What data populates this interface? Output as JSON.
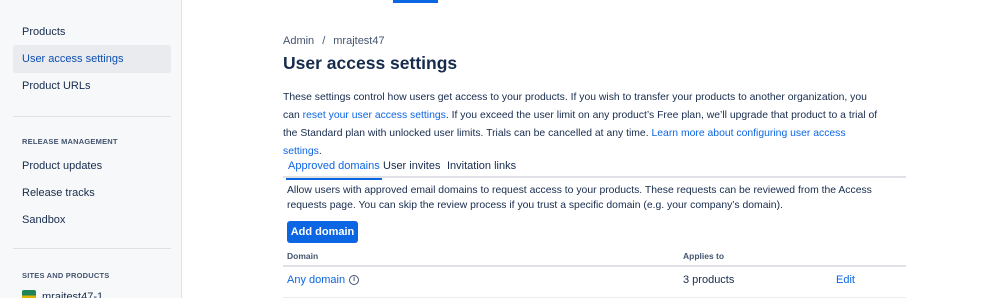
{
  "sidebar": {
    "items_top": [
      {
        "label": "Products"
      },
      {
        "label": "User access settings",
        "active": true
      },
      {
        "label": "Product URLs"
      }
    ],
    "release_heading": "RELEASE MANAGEMENT",
    "release_items": [
      {
        "label": "Product updates"
      },
      {
        "label": "Release tracks"
      },
      {
        "label": "Sandbox"
      }
    ],
    "sites_heading": "SITES AND PRODUCTS",
    "site": {
      "label": "mrajtest47-1",
      "icon": "site-icon"
    }
  },
  "breadcrumb": {
    "items": [
      "Admin",
      "mrajtest47"
    ],
    "separator": "/"
  },
  "page_title": "User access settings",
  "intro": {
    "part1": "These settings control how users get access to your products. If you wish to transfer your products to another organization, you can ",
    "link1": "reset your user access settings",
    "part2": ". If you exceed the user limit on any product’s Free plan, we’ll upgrade that product to a trial of the Standard plan with unlocked user limits. Trials can be cancelled at any time. ",
    "link2": "Learn more about configuring user access settings",
    "part3": "."
  },
  "tabs": [
    {
      "label": "Approved domains",
      "active": true
    },
    {
      "label": "User invites"
    },
    {
      "label": "Invitation links"
    }
  ],
  "tab_description": "Allow users with approved email domains to request access to your products. These requests can be reviewed from the Access requests page. You can skip the review process if you trust a specific domain (e.g. your company’s domain).",
  "add_button": "Add domain",
  "table": {
    "headers": [
      "Domain",
      "Applies to"
    ],
    "rows": [
      {
        "domain": "Any domain",
        "applies_to": "3 products",
        "action": "Edit"
      }
    ]
  },
  "colors": {
    "accent": "#0c66e4",
    "sidebar_bg": "#f7f8f9",
    "text": "#172b4d"
  }
}
